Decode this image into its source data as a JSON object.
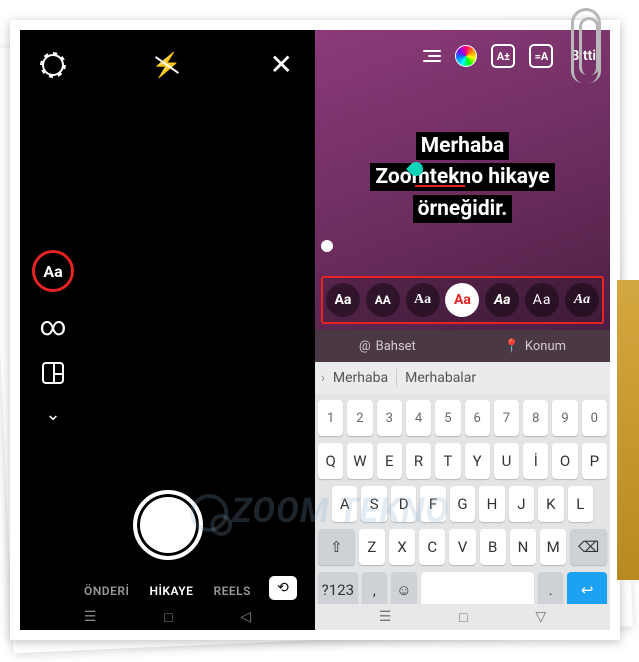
{
  "left": {
    "sidebar": {
      "aa": "Aa",
      "infinity": "∞"
    },
    "modes": {
      "prev": "ÖNDERİ",
      "active": "HİKAYE",
      "next": "REELS"
    }
  },
  "right": {
    "topbar": {
      "size_badge": "A±",
      "anim_badge": "=A",
      "done": "Bitti"
    },
    "story_text": {
      "line1": "Merhaba",
      "line2": "Zoomtekno hikaye",
      "line3": "örneğidir."
    },
    "fonts": [
      "Aa",
      "AA",
      "Aa",
      "Aa",
      "Aa",
      "Aa",
      "Aa"
    ],
    "suggestions": {
      "mention": "Bahset",
      "location": "Konum"
    },
    "predictions": [
      "Merhaba",
      "Merhabalar"
    ],
    "keyboard": {
      "row1": [
        "1",
        "2",
        "3",
        "4",
        "5",
        "6",
        "7",
        "8",
        "9",
        "0"
      ],
      "row2": [
        "Q",
        "W",
        "E",
        "R",
        "T",
        "Y",
        "U",
        "İ",
        "O",
        "P"
      ],
      "row3": [
        "A",
        "S",
        "D",
        "F",
        "G",
        "H",
        "J",
        "K",
        "L"
      ],
      "row4_mid": [
        "Z",
        "X",
        "C",
        "V",
        "B",
        "N",
        "M"
      ],
      "symkey": "?123",
      "enter": "↩"
    }
  },
  "watermark": "ZOOM TEKNO"
}
